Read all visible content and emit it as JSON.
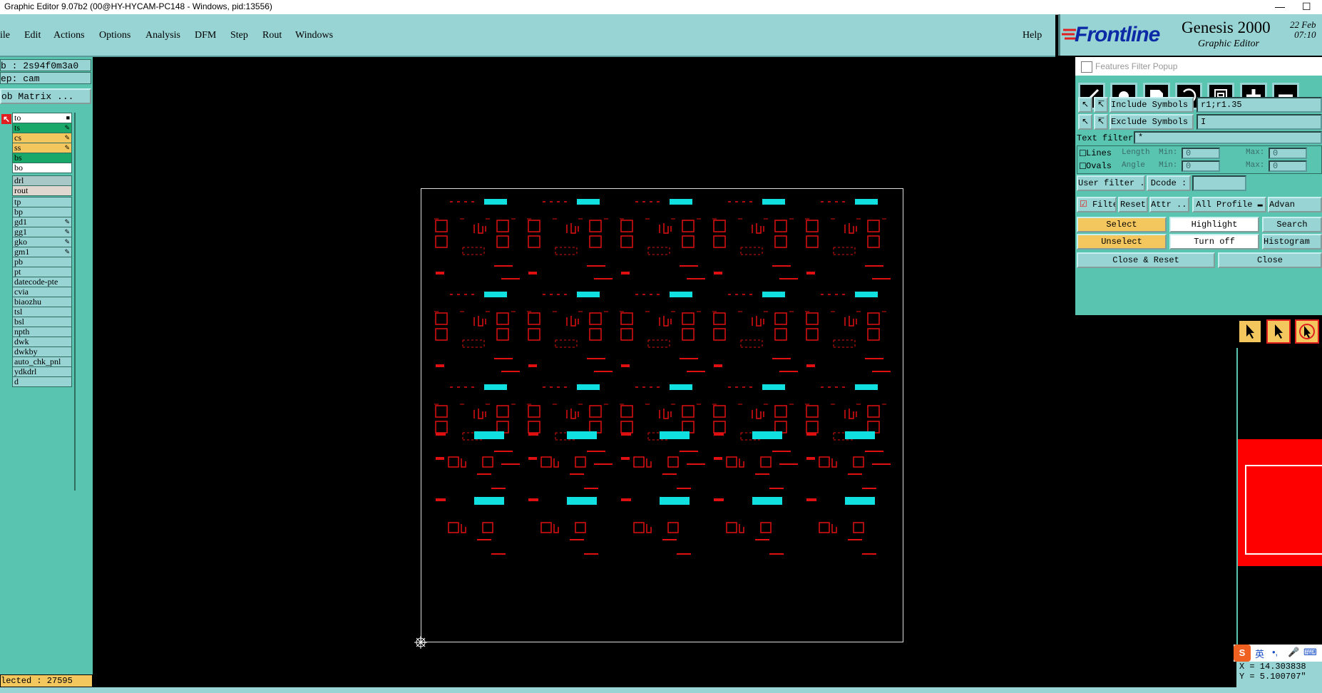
{
  "window": {
    "title": "Graphic Editor 9.07b2 (00@HY-HYCAM-PC148 - Windows, pid:13556)",
    "minimize": "—",
    "maximize": "☐"
  },
  "menu": {
    "items": [
      "ile",
      "Edit",
      "Actions",
      "Options",
      "Analysis",
      "DFM",
      "Step",
      "Rout",
      "Windows"
    ],
    "help": "Help"
  },
  "logo": {
    "brand": "Frontline",
    "product": "Genesis 2000",
    "subtitle": "Graphic Editor",
    "date": "22 Feb",
    "time": "07:10"
  },
  "left": {
    "job": "b : 2s94f0m3a0",
    "step": "ep: cam",
    "matrix_button": "ob Matrix ...",
    "layers": [
      {
        "name": "to",
        "color": "#ffffff"
      },
      {
        "name": "ts",
        "color": "#1aa86a"
      },
      {
        "name": "cs",
        "color": "#f4c75e"
      },
      {
        "name": "ss",
        "color": "#f4c75e"
      },
      {
        "name": "bs",
        "color": "#1aa86a"
      },
      {
        "name": "bo",
        "color": "#ffffff"
      },
      {
        "name": "drl",
        "color": "#a8c8c8"
      },
      {
        "name": "rout",
        "color": "#e0d8d0"
      },
      {
        "name": "tp",
        "color": "#98d4d4"
      },
      {
        "name": "bp",
        "color": "#98d4d4"
      },
      {
        "name": "gd1",
        "color": "#98d4d4"
      },
      {
        "name": "gg1",
        "color": "#98d4d4"
      },
      {
        "name": "gko",
        "color": "#98d4d4"
      },
      {
        "name": "gm1",
        "color": "#98d4d4"
      },
      {
        "name": "pb",
        "color": "#98d4d4"
      },
      {
        "name": "pt",
        "color": "#98d4d4"
      },
      {
        "name": "datecode-pte",
        "color": "#98d4d4"
      },
      {
        "name": "cvia",
        "color": "#98d4d4"
      },
      {
        "name": "biaozhu",
        "color": "#98d4d4"
      },
      {
        "name": "tsl",
        "color": "#98d4d4"
      },
      {
        "name": "bsl",
        "color": "#98d4d4"
      },
      {
        "name": "npth",
        "color": "#98d4d4"
      },
      {
        "name": "dwk",
        "color": "#98d4d4"
      },
      {
        "name": "dwkby",
        "color": "#98d4d4"
      },
      {
        "name": "auto_chk_pnl",
        "color": "#98d4d4"
      },
      {
        "name": "ydkdrl",
        "color": "#98d4d4"
      },
      {
        "name": "d",
        "color": "#98d4d4"
      }
    ],
    "selected": "lected : 27595"
  },
  "popup": {
    "title": "Features Filter Popup",
    "include_label": "Include Symbols :",
    "include_value": "r1;r1.35",
    "exclude_label": "Exclude Symbols :",
    "exclude_value": "I",
    "text_filter_label": "Text filter",
    "text_filter_value": "*",
    "lines": "Lines",
    "ovals": "Ovals",
    "length": "Length",
    "angle": "Angle",
    "min1": "Min:",
    "min2": "Min:",
    "max1": "Max:",
    "max2": "Max:",
    "zero": "0",
    "user_filter": "User filter ...",
    "dcode": "Dcode :",
    "filter": "Filter",
    "reset": "Reset",
    "attr": "Attr ...",
    "all_profile": "All Profile",
    "advanced": "Advan",
    "select": "Select",
    "highlight": "Highlight",
    "search": "Search",
    "unselect": "Unselect",
    "turn_off": "Turn off",
    "histogram": "Histogram",
    "close_reset": "Close & Reset",
    "close": "Close"
  },
  "coords": {
    "x": "X = 14.303838",
    "y": "Y = 5.100707\""
  },
  "ime": {
    "lang": "英"
  }
}
